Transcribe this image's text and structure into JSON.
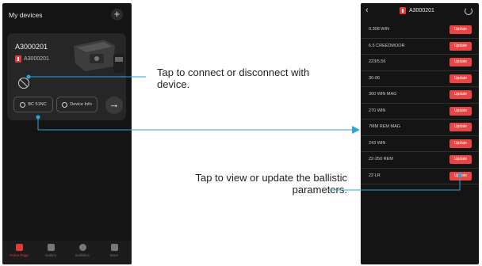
{
  "left_screen": {
    "title": "My devices",
    "plus_icon": "plus-icon",
    "device": {
      "name": "A3000201",
      "bt_name": "A3000201",
      "connect_pill": "BC 51NC",
      "info_pill": "Device Info",
      "arrow": "→"
    },
    "tabs": [
      {
        "label": "Home Page",
        "icon": "home-icon",
        "active": true
      },
      {
        "label": "Gallery",
        "icon": "gallery-icon",
        "active": false
      },
      {
        "label": "Ballistics",
        "icon": "ballistics-icon",
        "active": false
      },
      {
        "label": "More",
        "icon": "grid-icon",
        "active": false
      }
    ]
  },
  "right_screen": {
    "title": "A3000201",
    "back": "‹",
    "update_label": "Update",
    "calibers": [
      "0.308 WIN",
      "6.5 CREEDMOOR",
      "223/5.56",
      "30-06",
      "300 WIN MAG",
      "270 WIN",
      "7MM REM MAG",
      "243 WIN",
      "22-250 REM",
      "22 LR"
    ]
  },
  "annotations": {
    "connect": "Tap to connect or disconnect with device.",
    "update": "Tap to view or update the ballistic parameters."
  },
  "colors": {
    "accent": "#e84545",
    "arrow": "#2aa7d9",
    "background": "#141414"
  }
}
